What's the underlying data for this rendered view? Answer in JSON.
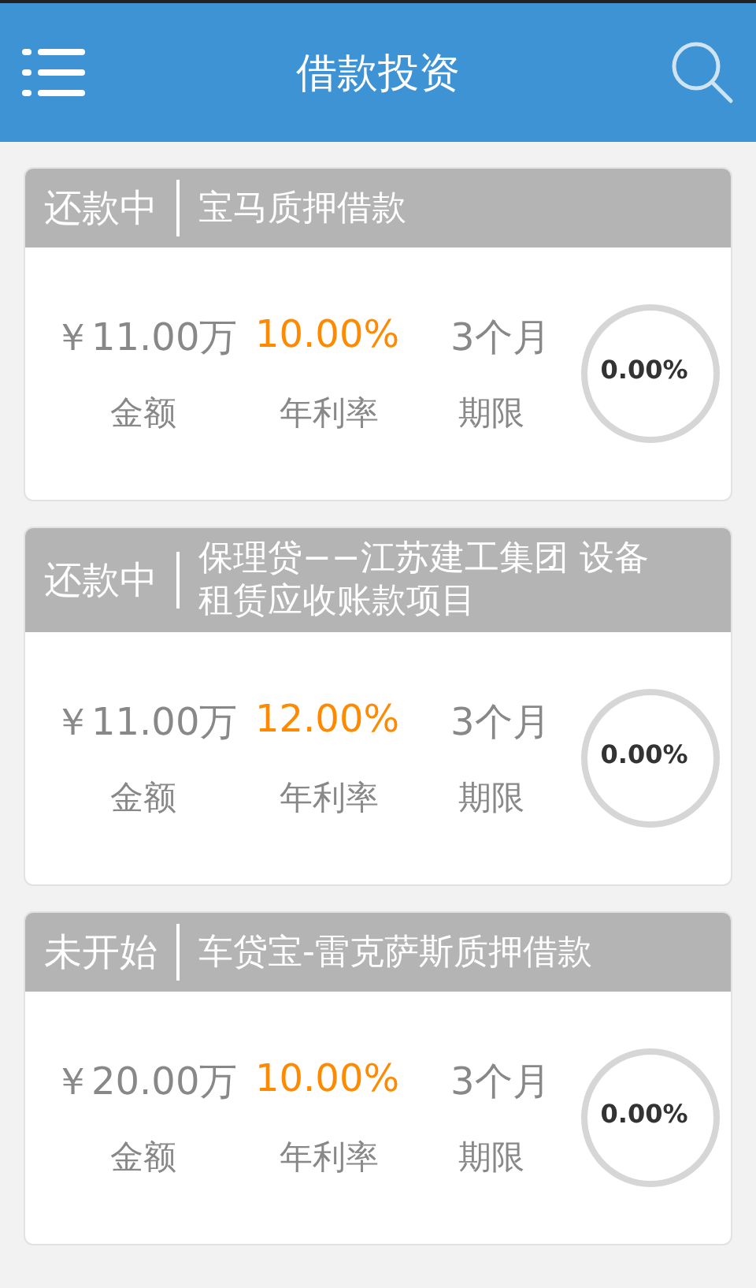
{
  "app_bar": {
    "title": "借款投资"
  },
  "loans": [
    {
      "status": "还款中",
      "name": "宝马质押借款",
      "amount": "￥11.00万",
      "rate": "10.00%",
      "term": "3个月",
      "amount_label": "金额",
      "rate_label": "年利率",
      "term_label": "期限",
      "progress": {
        "reading": "0.00%"
      }
    },
    {
      "status": "还款中",
      "name": "保理贷−−江苏建工集团 设备租赁应收账款项目",
      "amount": "￥11.00万",
      "rate": "12.00%",
      "term": "3个月",
      "amount_label": "金额",
      "rate_label": "年利率",
      "term_label": "期限",
      "progress": {
        "reading": "0.00%"
      }
    },
    {
      "status": "未开始",
      "name": "车贷宝-雷克萨斯质押借款",
      "amount": "￥20.00万",
      "rate": "10.00%",
      "term": "3个月",
      "amount_label": "金额",
      "rate_label": "年利率",
      "term_label": "期限",
      "progress": {
        "reading": "0.00%"
      }
    }
  ]
}
